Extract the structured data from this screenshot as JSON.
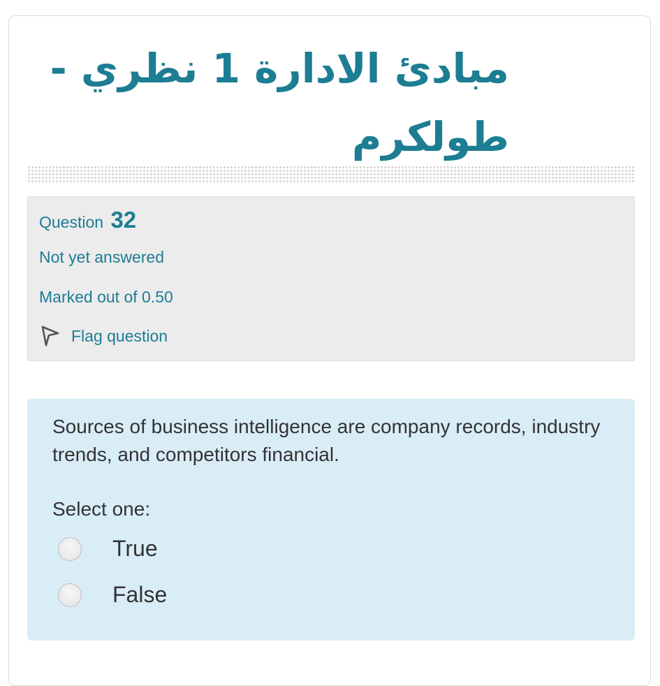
{
  "header": {
    "title": "مبادئ الادارة 1 نظري - طولكرم"
  },
  "question_info": {
    "question_label": "Question",
    "question_number": "32",
    "state": "Not yet answered",
    "grade": "Marked out of 0.50",
    "flag_label": "Flag question",
    "flag_icon": "flag-outline-icon"
  },
  "question": {
    "text": "Sources of business intelligence are company records, industry trends, and competitors financial.",
    "prompt": "Select one:",
    "options": [
      {
        "label": "True",
        "selected": false
      },
      {
        "label": "False",
        "selected": false
      }
    ]
  },
  "colors": {
    "accent": "#1c7d93",
    "info_bg": "#ececec",
    "question_bg": "#d9edf7",
    "text": "#333333"
  }
}
